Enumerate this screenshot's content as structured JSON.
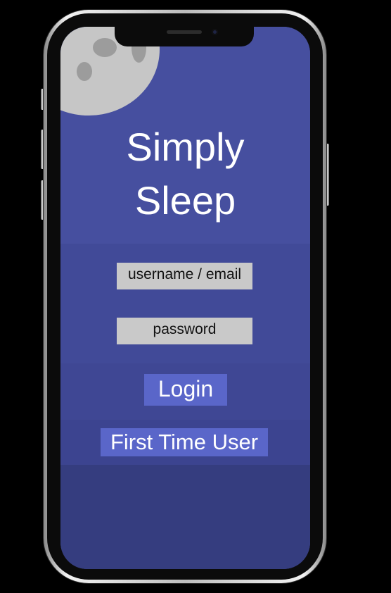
{
  "app": {
    "title_line1": "Simply",
    "title_line2": "Sleep"
  },
  "login_form": {
    "username_placeholder": "username / email",
    "password_placeholder": "password",
    "login_label": "Login",
    "first_time_label": "First Time User"
  },
  "colors": {
    "screen_background": "#464f9f",
    "button_background": "#5a66c9",
    "field_background": "#c9c9c9",
    "moon": "#c6c6c6"
  },
  "icons": {
    "moon": "moon-icon"
  }
}
